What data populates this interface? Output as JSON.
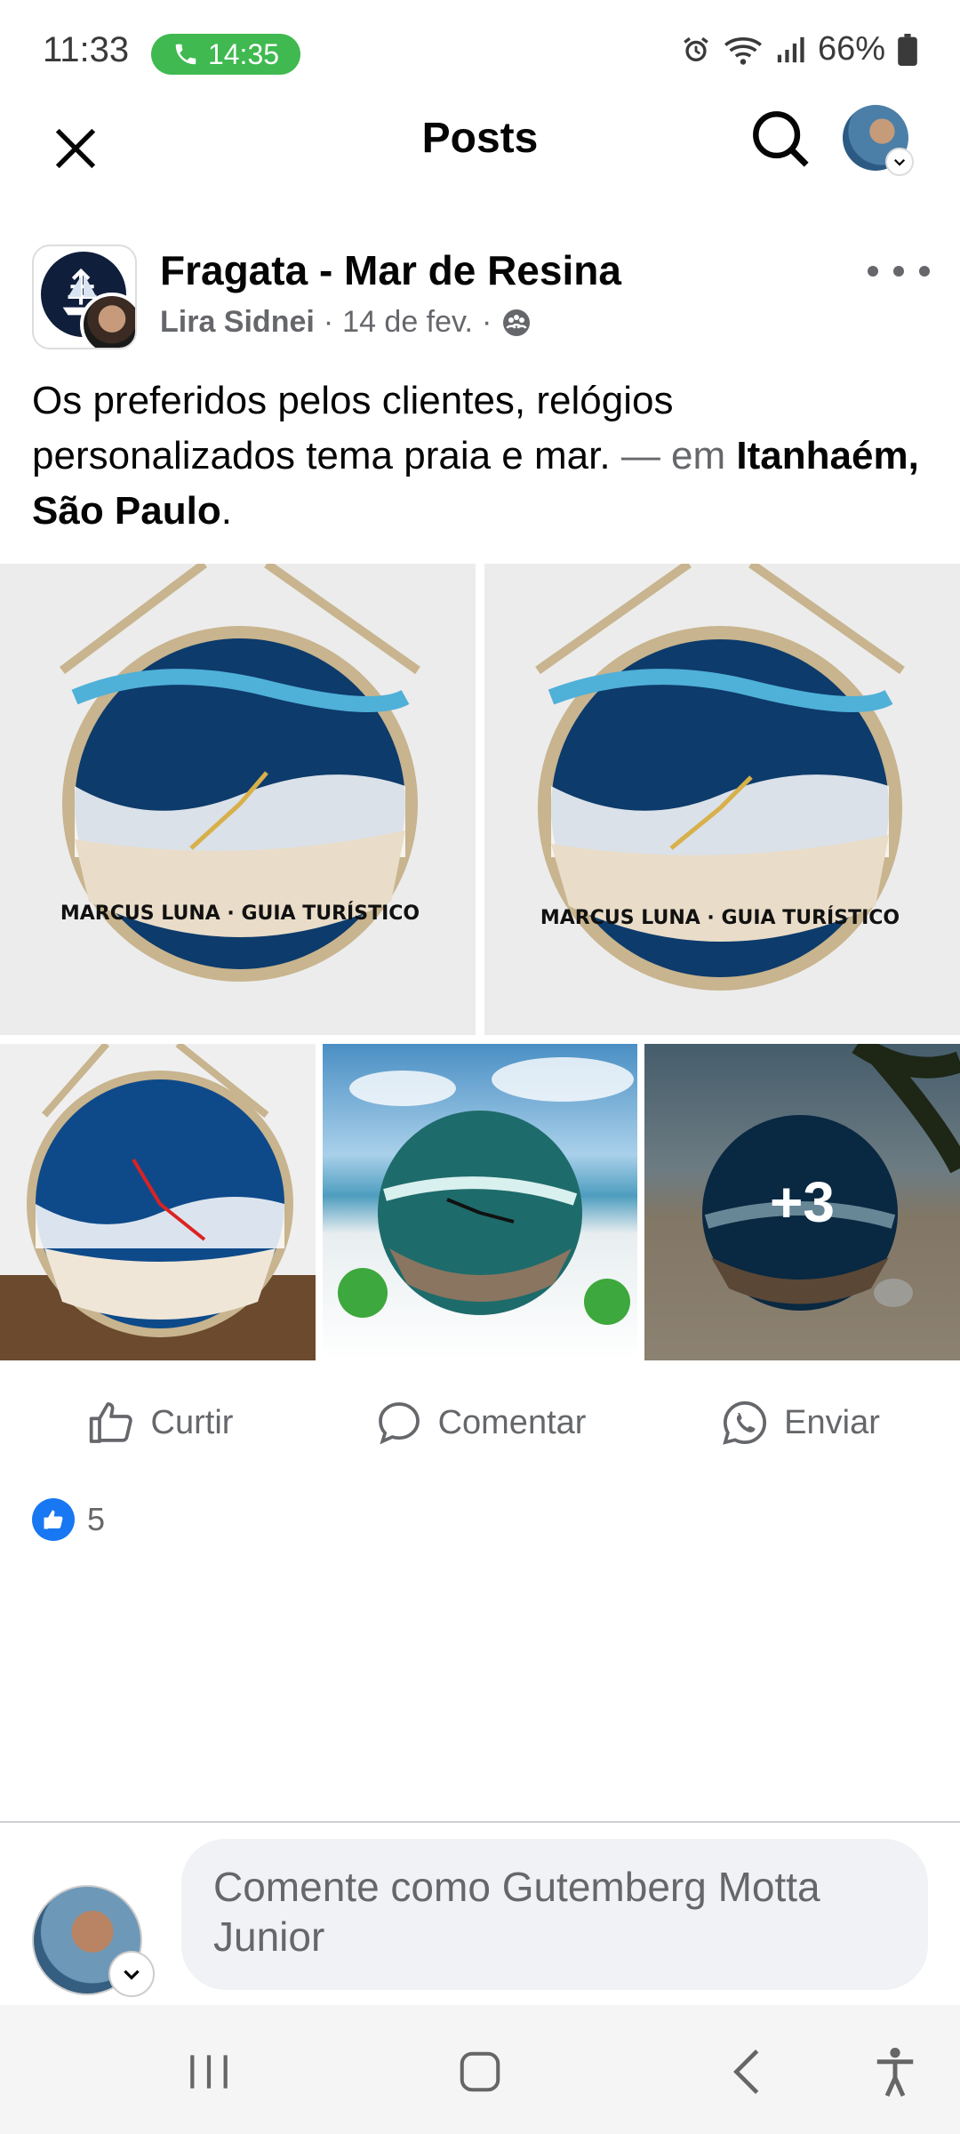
{
  "status_bar": {
    "time": "11:33",
    "call_duration": "14:35",
    "battery": "66%"
  },
  "app_bar": {
    "title": "Posts"
  },
  "post": {
    "page_name": "Fragata - Mar de Resina",
    "author": "Lira Sidnei",
    "date": "14 de fev.",
    "text_main": "Os preferidos pelos clientes, relógios personalizados tema praia e mar.",
    "location_prefix": "— em",
    "location": "Itanhaém, São Paulo",
    "location_suffix": ".",
    "photo_overflow": "+3"
  },
  "actions": {
    "like": "Curtir",
    "comment": "Comentar",
    "send": "Enviar"
  },
  "reactions": {
    "count": "5"
  },
  "composer": {
    "placeholder": "Comente como Gutemberg Motta Junior"
  },
  "colors": {
    "facebook_blue": "#1877f2",
    "call_green": "#3fb950",
    "secondary_text": "#65676b"
  }
}
